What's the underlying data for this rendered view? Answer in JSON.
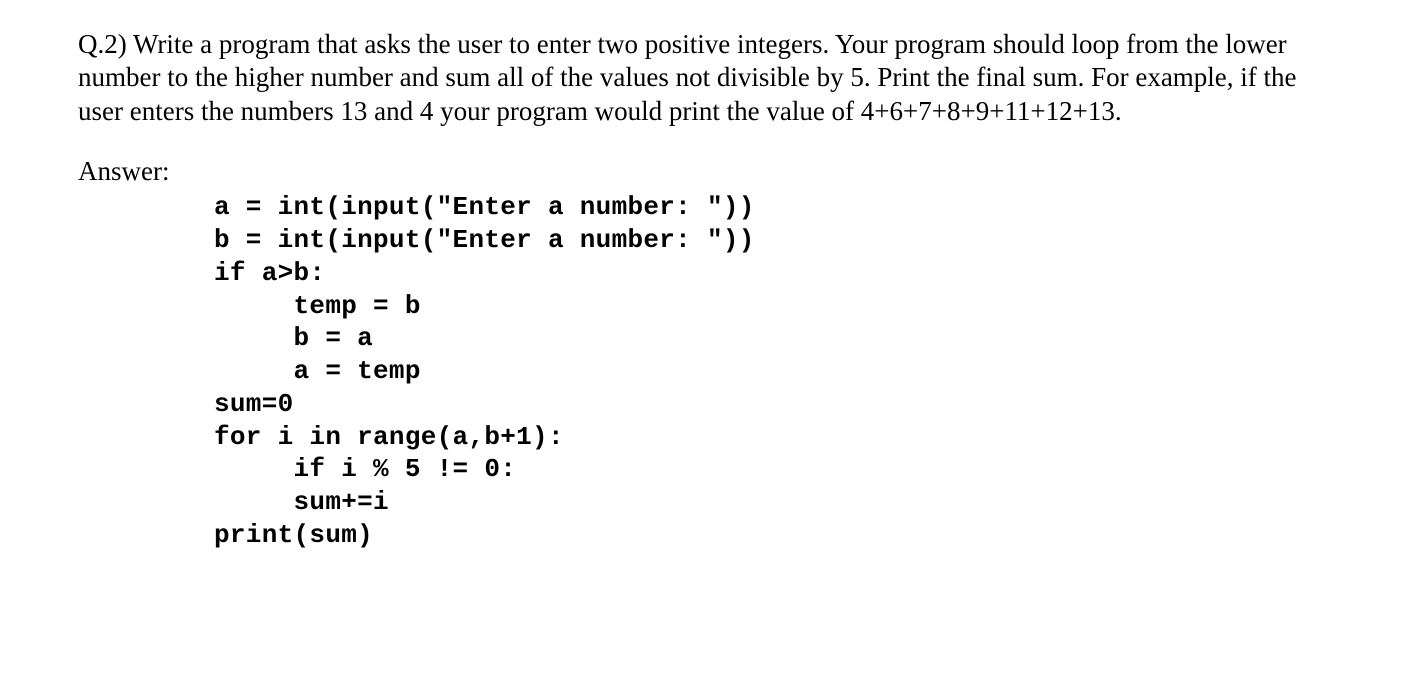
{
  "question": {
    "text": "Q.2) Write a program that asks the user to enter two positive integers. Your program should loop from the lower number to the higher number and sum all of the values not divisible by 5. Print the final sum. For example, if the user enters the numbers 13 and 4 your program would print the value of  4+6+7+8+9+11+12+13."
  },
  "answer": {
    "label": "Answer:",
    "code": "a = int(input(\"Enter a number: \"))\nb = int(input(\"Enter a number: \"))\nif a>b:\n     temp = b\n     b = a\n     a = temp\nsum=0\nfor i in range(a,b+1):\n     if i % 5 != 0:\n     sum+=i\nprint(sum)"
  }
}
